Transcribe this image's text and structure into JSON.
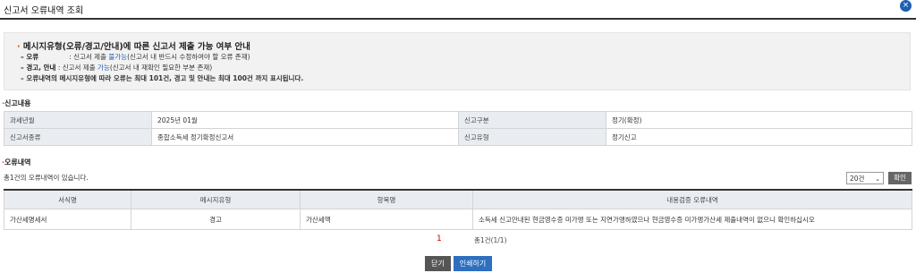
{
  "window": {
    "title": "신고서 오류내역 조회",
    "close_icon_glyph": "×"
  },
  "notice": {
    "heading": "메시지유형(오류/경고/안내)에 따른 신고서 제출 가능 여부 안내",
    "line1_label": "– 오류",
    "line1_sep": ":",
    "line1_pre": "신고서 제출",
    "line1_emph": "불가능",
    "line1_post": "(신고서 내 반드시 수정하여야 할 오류 존재)",
    "line2_label": "– 경고, 안내",
    "line2_pre": ": 신고서 제출",
    "line2_emph": "가능",
    "line2_post": "(신고서 내 재확인 필요한 부분 존재)",
    "line3": "– 오류내역의 메시지유형에 따라 오류는 최대 101건, 경고 및 안내는 최대 100건 까지 표시됩니다."
  },
  "report_section": {
    "title": "신고내용"
  },
  "report_table": [
    {
      "l1": "과세년월",
      "v1": "2025년 01월",
      "l2": "신고구분",
      "v2": "정기(확정)"
    },
    {
      "l1": "신고서종류",
      "v1": "종합소득세 정기확정신고서",
      "l2": "신고유형",
      "v2": "정기신고"
    }
  ],
  "error_section": {
    "title": "오류내역",
    "count_text": "총1건의 오류내역이 있습니다."
  },
  "page_size": {
    "selected": "20건"
  },
  "confirm_button": "확인",
  "error_table": {
    "headers": [
      "서식명",
      "메시지유형",
      "항목명",
      "내용검증 오류내역"
    ],
    "rows": [
      {
        "form": "가산세명세서",
        "type": "경고",
        "item": "가산세액",
        "detail": "소득세 신고안내된 현금영수증 미가맹 또는 지연가맹하였으나 현금영수증 미가맹가산세 제출내역이 없으니 확인하십시오"
      }
    ]
  },
  "pagination": {
    "current": "1",
    "summary": "총1건(1/1)"
  },
  "buttons": {
    "close": "닫기",
    "print": "인쇄하기"
  },
  "colors": {
    "accent": "#1f5fb2",
    "orange": "#e04a10"
  }
}
